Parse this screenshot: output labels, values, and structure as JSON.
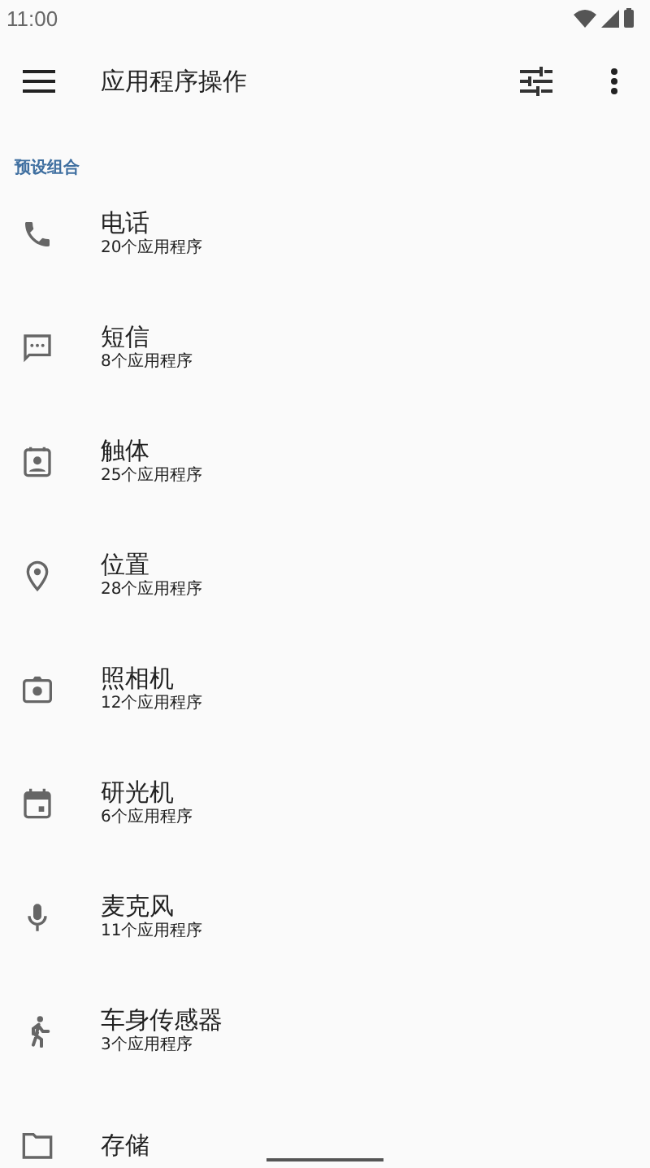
{
  "status_bar": {
    "time": "11:00"
  },
  "toolbar": {
    "title": "应用程序操作"
  },
  "section": {
    "title": "预设组合"
  },
  "items": [
    {
      "kind": "phone",
      "name": "电话",
      "count": "20个应用程序"
    },
    {
      "kind": "message",
      "name": "短信",
      "count": "8个应用程序"
    },
    {
      "kind": "contact",
      "name": "触体",
      "count": "25个应用程序"
    },
    {
      "kind": "location",
      "name": "位置",
      "count": "28个应用程序"
    },
    {
      "kind": "camera",
      "name": "照相机",
      "count": "12个应用程序"
    },
    {
      "kind": "calendar",
      "name": "研光机",
      "count": "6个应用程序"
    },
    {
      "kind": "mic",
      "name": "麦克风",
      "count": "11个应用程序"
    },
    {
      "kind": "run",
      "name": "车身传感器",
      "count": "3个应用程序"
    },
    {
      "kind": "folder",
      "name": "存储"
    }
  ]
}
